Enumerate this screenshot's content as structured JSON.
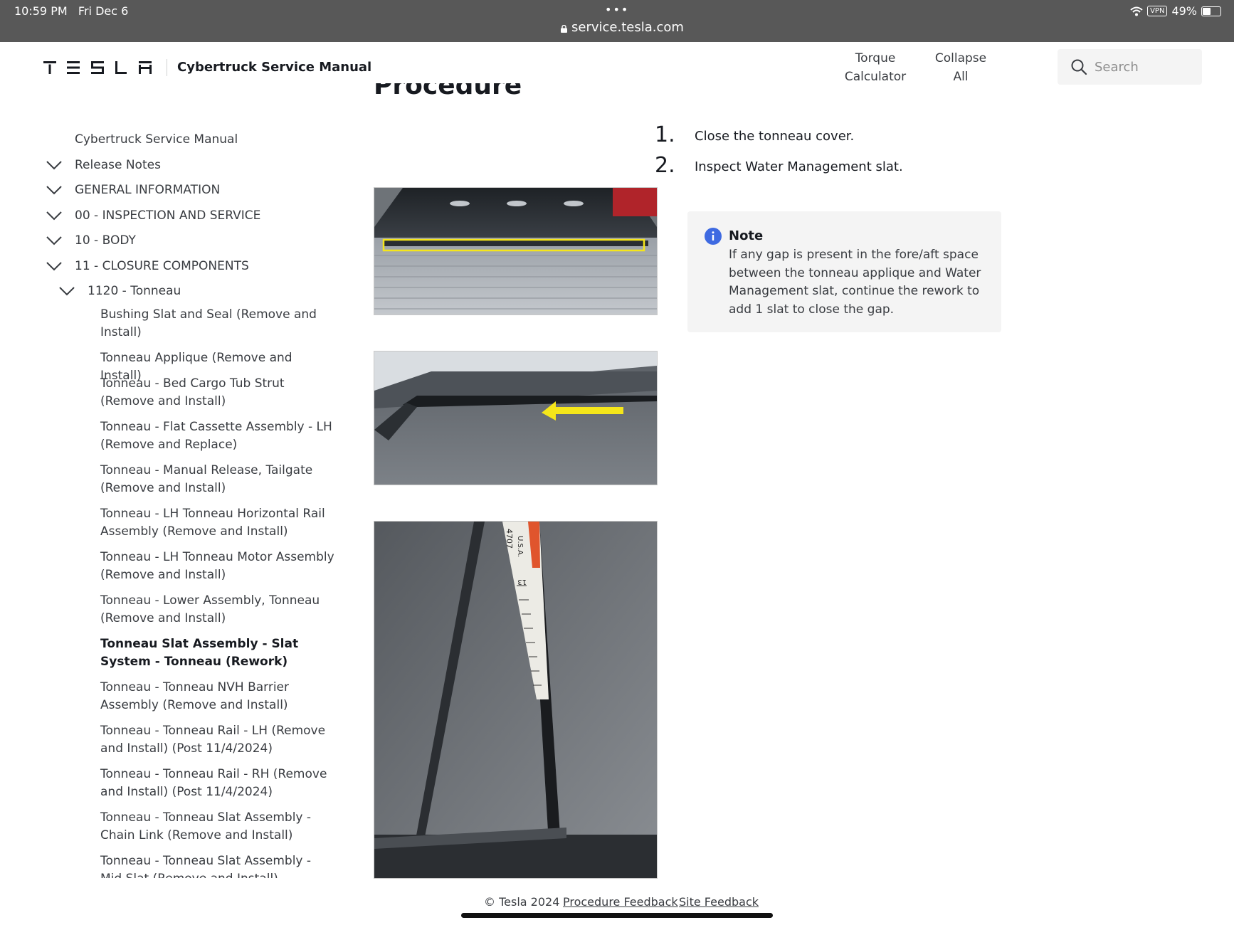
{
  "status_bar": {
    "time": "10:59 PM",
    "date": "Fri Dec 6",
    "dots": "•••",
    "url": "service.tesla.com",
    "vpn": "VPN",
    "battery": "49%"
  },
  "header": {
    "brand": "TESLA",
    "manual_title": "Cybertruck Service Manual",
    "torque_line1": "Torque",
    "torque_line2": "Calculator",
    "collapse_line1": "Collapse",
    "collapse_line2": "All",
    "search_placeholder": "Search"
  },
  "sidebar": {
    "root": "Cybertruck Service Manual",
    "sections": [
      "Release Notes",
      "GENERAL INFORMATION",
      "00 - INSPECTION AND SERVICE",
      "10 - BODY",
      "11 - CLOSURE COMPONENTS"
    ],
    "subsection": "1120 - Tonneau",
    "items": [
      "Bushing Slat and Seal (Remove and Install)",
      "Tonneau Applique (Remove and Install)",
      "Tonneau - Bed Cargo Tub Strut (Remove and Install)",
      "Tonneau - Flat Cassette Assembly - LH (Remove and Replace)",
      "Tonneau - Manual Release, Tailgate (Remove and Install)",
      "Tonneau - LH Tonneau Horizontal Rail Assembly (Remove and Install)",
      "Tonneau - LH Tonneau Motor Assembly (Remove and Install)",
      "Tonneau - Lower Assembly, Tonneau (Remove and Install)",
      "Tonneau Slat Assembly - Slat System - Tonneau (Rework)",
      "Tonneau - Tonneau NVH Barrier Assembly (Remove and Install)",
      "Tonneau - Tonneau Rail - LH (Remove and Install) (Post 11/4/2024)",
      "Tonneau - Tonneau Rail - RH (Remove and Install) (Post 11/4/2024)",
      "Tonneau - Tonneau Slat Assembly - Chain Link (Remove and Install)",
      "Tonneau - Tonneau Slat Assembly - Mid Slat (Remove and Install)"
    ]
  },
  "main": {
    "heading": "Procedure",
    "steps": [
      {
        "num": "1.",
        "text": "Close the tonneau cover."
      },
      {
        "num": "2.",
        "text": "Inspect Water Management slat."
      }
    ],
    "note_title": "Note",
    "note_body": "If any gap is present in the fore/aft space between the tonneau applique and Water Management slat, continue the rework to add 1 slat to close the gap.",
    "tape_label_1": "4707",
    "tape_label_2": "U.S.A.",
    "tape_number": "13"
  },
  "footer": {
    "copyright": "© Tesla 2024",
    "procedure_feedback": "Procedure Feedback",
    "site_feedback": "Site Feedback"
  },
  "colors": {
    "status_bar_bg": "#585858",
    "info_blue": "#3e6ae1",
    "highlight_yellow": "#f5e61a"
  }
}
